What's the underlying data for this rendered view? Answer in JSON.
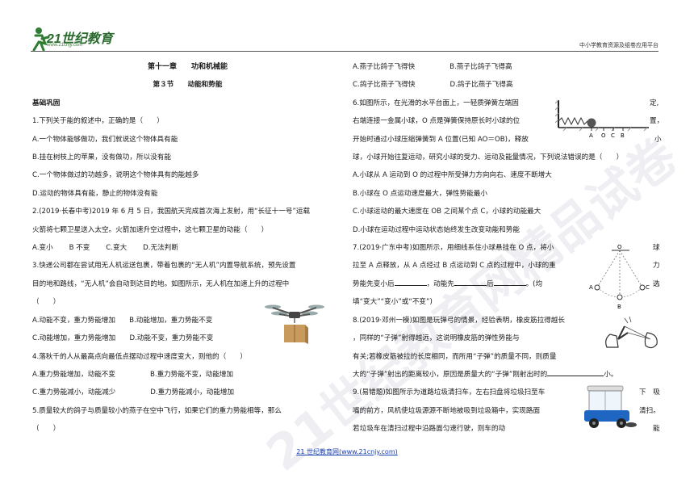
{
  "header": {
    "logo_text": "21世纪教育",
    "logo_url": "www.21cnjy.com",
    "right": "中小学教育资源及组卷应用平台"
  },
  "left": {
    "chapter": "第十一章　　功和机械能",
    "section": "第３节　　动能和势能",
    "basic": "基础巩固",
    "q1": "1.下列关于能的叙述中，正确的是（　　）",
    "q1a": "A.一个物体能够做功，我们就说这个物体具有能",
    "q1b": "B.挂在树枝上的苹果，没有做功，所以没有能",
    "q1c": "C.一个物体做过的功越多，说明这个物体具有的能越多",
    "q1d": "D.运动的物体具有能，静止的物体没有能",
    "q2_1": "2.(2019·长春中考)2019 年 6 月 5 日，我国航天完成首次海上发射，用“长征十一号”运载",
    "q2_2": "火箭将七颗卫星送入太空。火箭加速升空过程中，这七颗卫星的动能（　　）",
    "q2_opts": "A.变小　　 B 不变　　 C.变大　　 D.无法判断",
    "q3_1": "3.快递公司都在尝试用无人机运送包裹，带着包裹的“无人机”内置导航系统，预先设置",
    "q3_2": "目的地和路线，“无人机”会自动到达目的地。如图所示，无人机在加速上升的过程中",
    "q3_3": "（　　）",
    "q3_ab": "A.动能不变，重力势能增加　　B.动能增加，重力势能不变",
    "q3_cd": "C.动能增加，重力势能增加　　D.动能不变，重力势能不变",
    "q4": "4.落秋千的人从最高点向最低点摆动过程中速度变大，则他的（　　）",
    "q4_ab": "A.重力势能增加，动能不变　　　　　B.重力势能不变，动能增加",
    "q4_cd": "C.重力势能减小，动能减少　　　　　D.重力势能减小，动能增加",
    "q5_1": "5.质量较大的鸽子与质量较小的燕子在空中飞行，如果它们的重力势能相等，那么",
    "q5_2": "（　　）"
  },
  "right": {
    "q5_ab": "A.燕子比鸽子飞得快　　　　　B.燕子比鸽子飞得高",
    "q5_cd": "C.鸽子比燕子飞得快　　　　　D.鸽子比燕子飞得高",
    "q6_1": "6.如图所示，在光滑的水平台面上，一轻质弹簧左端固",
    "q6_1b": "定,",
    "q6_2": "右端连接一金属小球，O 点是弹簧保持原长时小球的位",
    "q6_2b": "置，",
    "q6_3": "开始时通过小球压缩弹簧到 A 位置(已知 AO＝OB)，释放",
    "q6_3b": "小",
    "q6_4": "球，小球开始往复运动，研究小球的受力、运动及能量情况，下列说法错误的是（　　）",
    "q6_a": "A.小球从 A 运动到 O 的过程中所受弹力方向向右、速度不断增大",
    "q6_b": "B.小球在 O 点运动速度最大，弹性势能最小",
    "q6_c": "C.小球运动的最大速度在 OB 之间某个点 C，小球的动能最大",
    "q6_d": "D.小球在运动过程中运动状态始终发生改变动能和势能",
    "q7_1": "7.(2019·广东中考)如图所示，用细线系住小球悬挂在 O 点，将小",
    "q7_1b": "球",
    "q7_2": "拉至 A 点释放，从 A 点经过 B 点运动到 C 点的过程中，小球的重",
    "q7_2b": "力",
    "q7_3a": "势能先变小后",
    "q7_3b": "，动能先",
    "q7_3c": "后",
    "q7_3d": "。(均",
    "q7_3e": "选",
    "q7_4": "填“变大”“变小”或“不变”)",
    "q8_1": "8.(2019·邓州一模)如图是玩弹弓的情景，经验表明，橡皮筋拉得越长",
    "q8_2": "，同样的“子弹”射得越远，这说明橡皮筋的弹性势能与",
    "q8_3": "有关;若橡皮筋被拉的长度相同，而所用“子弹”的质量不同，则质量",
    "q8_4": "大的“子弹”射出的距离较小，原因是质量大的“子弹”刚射出时的",
    "q8_4b": "小。",
    "q9_1": "9.(易错题)如图所示为道路垃圾清扫车，左右扫盘将垃圾扫至车",
    "q9_1b": "下　吸",
    "q9_2": "嘴的前方，风机使垃圾源源不断地被吸到垃圾箱中，实现路面",
    "q9_2b": "清扫。",
    "q9_3": "若垃圾车在清扫过程中沿路面匀速行驶，则车的动",
    "q9_3b": "能"
  },
  "figures": {
    "spring_labels": [
      "A",
      "O",
      "C",
      "B"
    ],
    "pendulum_labels": [
      "O",
      "A",
      "B",
      "C"
    ]
  },
  "footer": "21 世纪教育网(www.21cnjy.com)",
  "watermark": "21世纪教育网精品试卷"
}
